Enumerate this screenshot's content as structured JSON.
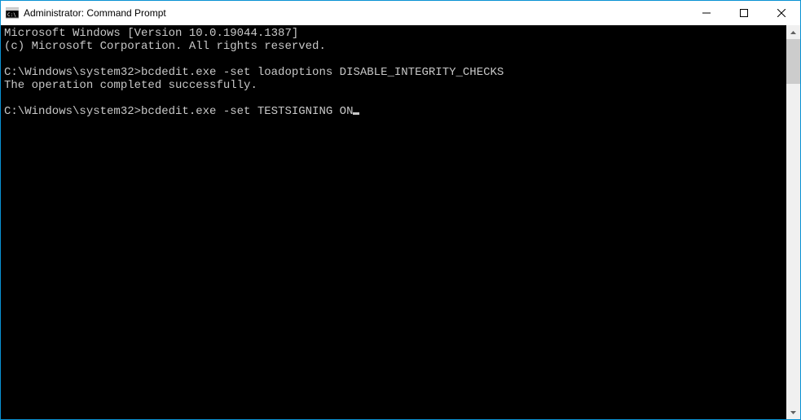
{
  "window": {
    "title": "Administrator: Command Prompt"
  },
  "terminal": {
    "lines": [
      "Microsoft Windows [Version 10.0.19044.1387]",
      "(c) Microsoft Corporation. All rights reserved.",
      "",
      "C:\\Windows\\system32>bcdedit.exe -set loadoptions DISABLE_INTEGRITY_CHECKS",
      "The operation completed successfully.",
      "",
      "C:\\Windows\\system32>bcdedit.exe -set TESTSIGNING ON"
    ],
    "cursor_after_last": true
  }
}
